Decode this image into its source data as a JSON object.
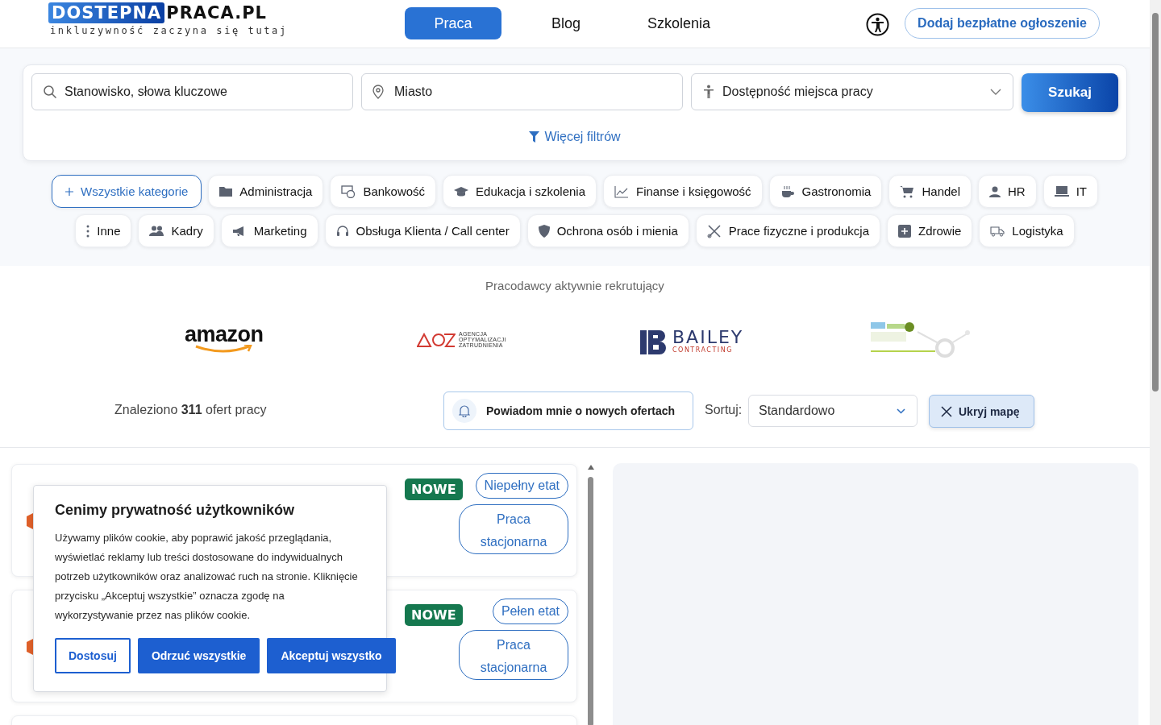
{
  "logo": {
    "brand_part_1": "DOSTEPNA",
    "brand_part_2": "PRACA.PL",
    "tagline": "inkluzywność zaczyna się tutaj"
  },
  "nav": [
    {
      "label": "Praca",
      "selected": true
    },
    {
      "label": "Blog",
      "selected": false
    },
    {
      "label": "Szkolenia",
      "selected": false
    }
  ],
  "add_listing_button": "Dodaj bezpłatne ogłoszenie",
  "search": {
    "keyword_placeholder": "Stanowisko, słowa kluczowe",
    "city_placeholder": "Miasto",
    "accessibility_select": "Dostępność miejsca pracy",
    "search_button": "Szukaj",
    "more_filters": "Więcej filtrów"
  },
  "category_rows": [
    {
      "items": [
        {
          "label": "Wszystkie kategorie",
          "selected": true
        },
        {
          "label": "Administracja",
          "selected": false
        },
        {
          "label": "Bankowość",
          "selected": false
        },
        {
          "label": "Edukacja i szkolenia",
          "selected": false
        },
        {
          "label": "Finanse i księgowość",
          "selected": false
        },
        {
          "label": "Gastronomia",
          "selected": false
        },
        {
          "label": "Handel",
          "selected": false
        },
        {
          "label": "HR",
          "selected": false
        },
        {
          "label": "IT",
          "selected": false
        }
      ]
    },
    {
      "items": [
        {
          "label": "Inne",
          "selected": false
        },
        {
          "label": "Kadry",
          "selected": false
        },
        {
          "label": "Marketing",
          "selected": false
        },
        {
          "label": "Obsługa Klienta / Call center",
          "selected": false
        },
        {
          "label": "Ochrona osób i mienia",
          "selected": false
        },
        {
          "label": "Prace fizyczne i produkcja",
          "selected": false
        },
        {
          "label": "Zdrowie",
          "selected": false
        },
        {
          "label": "Logistyka",
          "selected": false
        }
      ]
    }
  ],
  "employers": {
    "heading": "Pracodawcy aktywnie rekrutujący",
    "logos": [
      {
        "kind": "amazon",
        "texts": [
          "amazon"
        ]
      },
      {
        "kind": "aoz",
        "texts": [
          "AGENCJA",
          "OPTYMALIZACJI",
          "ZATRUDNIENIA"
        ]
      },
      {
        "kind": "bailey",
        "texts": [
          "BAILEY",
          "CONTRACTING"
        ]
      },
      {
        "kind": "picture"
      }
    ]
  },
  "results": {
    "found_prefix": "Znaleziono",
    "count": "311",
    "found_suffix": "ofert pracy",
    "notify_button": "Powiadom mnie o nowych ofertach",
    "sort_label": "Sortuj:",
    "sort_value": "Standardowo",
    "hide_map_button": "Ukryj mapę"
  },
  "jobs": [
    {
      "badge": "NOWE",
      "tags": [
        "Niepełny etat",
        "Praca stacjonarna"
      ]
    },
    {
      "badge": "NOWE",
      "tags": [
        "Pełen etat",
        "Praca stacjonarna"
      ]
    }
  ],
  "cookie_dialog": {
    "title": "Cenimy prywatność użytkowników",
    "text": "Używamy plików cookie, aby poprawić jakość przeglądania, wyświetlać reklamy lub treści dostosowane do indywidualnych potrzeb użytkowników oraz analizować ruch na stronie. Kliknięcie przycisku „Akceptuj wszystkie” oznacza zgodę na wykorzystywanie przez nas plików cookie.",
    "buttons": [
      {
        "label": "Dostosuj",
        "kind": "outline"
      },
      {
        "label": "Odrzuć wszystkie",
        "kind": "solid"
      },
      {
        "label": "Akceptuj wszystko",
        "kind": "solid"
      }
    ]
  }
}
